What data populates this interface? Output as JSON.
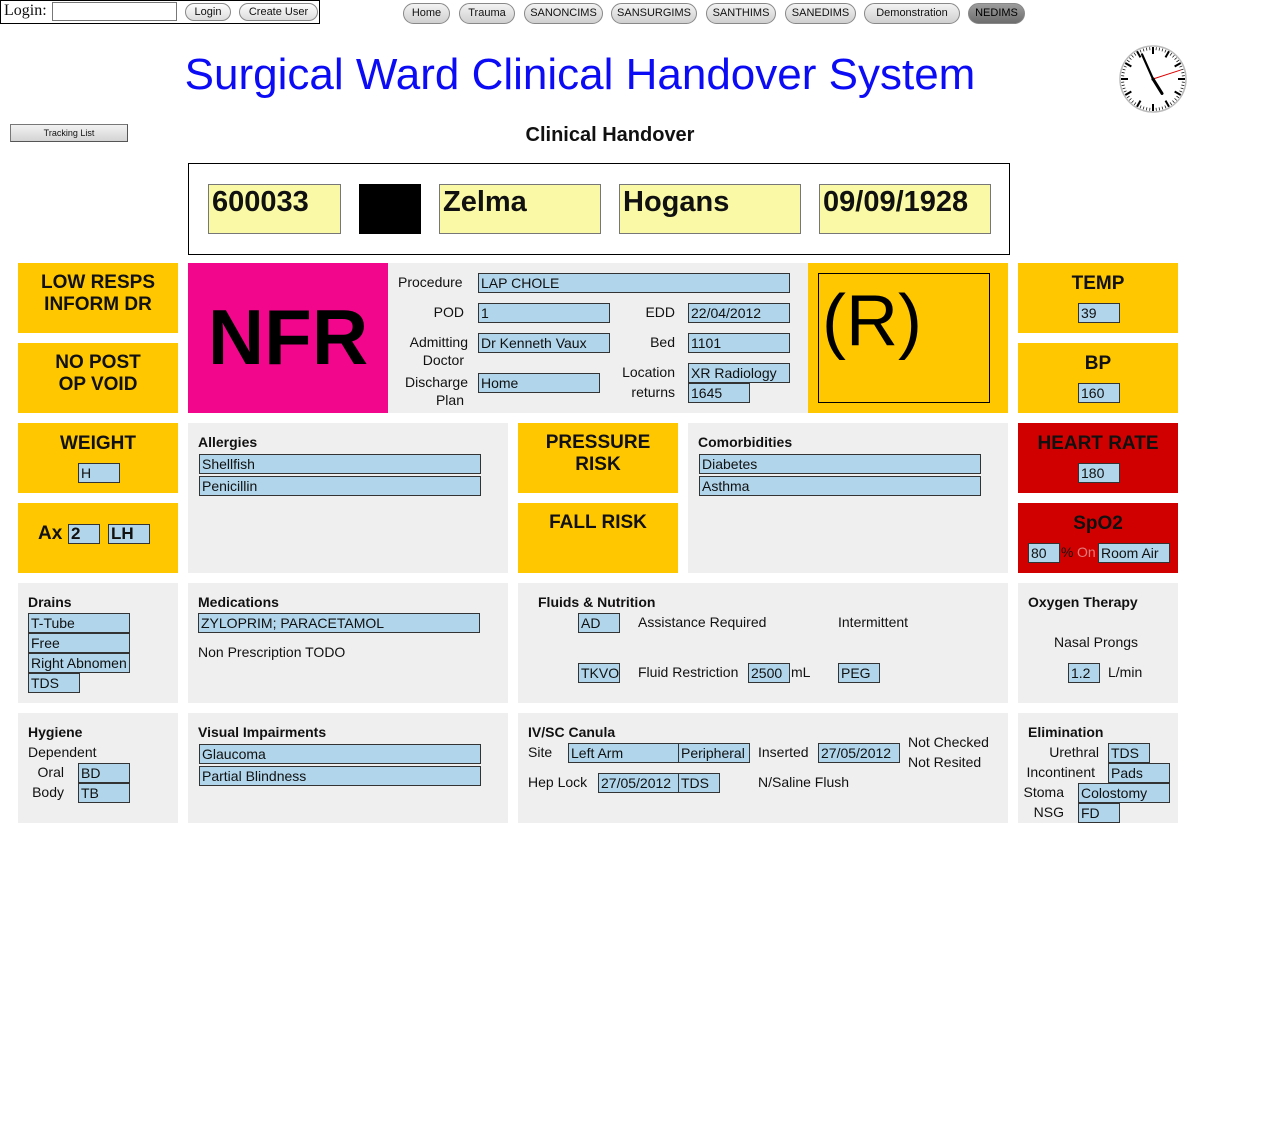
{
  "login": {
    "label": "Login:",
    "username_value": "",
    "login_button": "Login",
    "create_user_button": "Create User"
  },
  "nav": {
    "tabs": [
      {
        "label": "Home"
      },
      {
        "label": "Trauma"
      },
      {
        "label": "SANONCIMS"
      },
      {
        "label": "SANSURGIMS"
      },
      {
        "label": "SANTHIMS"
      },
      {
        "label": "SANEDIMS"
      },
      {
        "label": "Demonstration"
      },
      {
        "label": "NEDIMS"
      }
    ],
    "active": "NEDIMS"
  },
  "header": {
    "title": "Surgical Ward Clinical Handover System",
    "subtitle": "Clinical Handover",
    "tracking_list_button": "Tracking List"
  },
  "patient": {
    "id": "600033",
    "first_name": "Zelma",
    "last_name": "Hogans",
    "dob": "09/09/1928"
  },
  "alerts": {
    "low_resps": "LOW RESPS INFORM DR",
    "no_post_op_void": "NO POST OP VOID",
    "weight_label": "WEIGHT",
    "weight_value": "H",
    "ax_label": "Ax",
    "ax_value": "2",
    "ax_side": "LH",
    "nfr": "NFR",
    "pressure_risk": "PRESSURE RISK",
    "fall_risk": "FALL RISK",
    "r_marker": "(R)"
  },
  "procedure": {
    "procedure_label": "Procedure",
    "procedure_value": "LAP CHOLE",
    "pod_label": "POD",
    "pod_value": "1",
    "edd_label": "EDD",
    "edd_value": "22/04/2012",
    "admitting_label_1": "Admitting",
    "admitting_label_2": "Doctor",
    "admitting_value": "Dr Kenneth Vaux",
    "bed_label": "Bed",
    "bed_value": "1101",
    "discharge_label_1": "Discharge",
    "discharge_label_2": "Plan",
    "discharge_value": "Home",
    "location_label": "Location",
    "location_value": "XR Radiology",
    "returns_label": "returns",
    "returns_value": "1645"
  },
  "vitals": {
    "temp_label": "TEMP",
    "temp_value": "39",
    "bp_label": "BP",
    "bp_value": "160",
    "hr_label": "HEART RATE",
    "hr_value": "180",
    "spo2_label": "SpO2",
    "spo2_value": "80",
    "spo2_pct": "%",
    "spo2_on": "On",
    "spo2_source": "Room Air"
  },
  "allergies": {
    "title": "Allergies",
    "items": [
      "Shellfish",
      "Penicillin"
    ]
  },
  "comorbidities": {
    "title": "Comorbidities",
    "items": [
      "Diabetes",
      "Asthma"
    ]
  },
  "drains": {
    "title": "Drains",
    "items": [
      "T-Tube",
      "Free",
      "Right Abnomen",
      "TDS"
    ]
  },
  "medications": {
    "title": "Medications",
    "value": "ZYLOPRIM; PARACETAMOL",
    "note": "Non Prescription TODO"
  },
  "fluids": {
    "title": "Fluids & Nutrition",
    "diet_value": "AD",
    "assistance": "Assistance Required",
    "intermittent": "Intermittent",
    "iv_value": "TKVO",
    "restriction_label": "Fluid Restriction",
    "restriction_value": "2500",
    "restriction_unit": "mL",
    "feed_value": "PEG"
  },
  "oxygen": {
    "title": "Oxygen Therapy",
    "device": "Nasal Prongs",
    "rate_value": "1.2",
    "rate_unit": "L/min"
  },
  "hygiene": {
    "title": "Hygiene",
    "status": "Dependent",
    "oral_label": "Oral",
    "oral_value": "BD",
    "body_label": "Body",
    "body_value": "TB"
  },
  "visual": {
    "title": "Visual Impairments",
    "items": [
      "Glaucoma",
      "Partial Blindness"
    ]
  },
  "ivsc": {
    "title": "IV/SC Canula",
    "site_label": "Site",
    "site_value": "Left Arm",
    "site_type": "Peripheral",
    "inserted_label": "Inserted",
    "inserted_value": "27/05/2012",
    "not_checked": "Not Checked",
    "not_resited": "Not Resited",
    "hep_lock_label": "Hep Lock",
    "hep_lock_date": "27/05/2012",
    "hep_lock_freq": "TDS",
    "flush": "N/Saline Flush"
  },
  "elimination": {
    "title": "Elimination",
    "urethral_label": "Urethral",
    "urethral_value": "TDS",
    "incontinent_label": "Incontinent",
    "incontinent_value": "Pads",
    "stoma_label": "Stoma",
    "stoma_value": "Colostomy",
    "nsg_label": "NSG",
    "nsg_value": "FD"
  },
  "colors": {
    "title_blue": "#0b0bf5",
    "alert_yellow": "#fec700",
    "alert_red": "#d10000",
    "nfr_magenta": "#f2068c",
    "field_blue": "#b1d5ea",
    "patient_field": "#fafaa6",
    "panel_grey": "#efefef"
  },
  "clock": {
    "hour": 4,
    "minute": 56,
    "second": 12
  }
}
